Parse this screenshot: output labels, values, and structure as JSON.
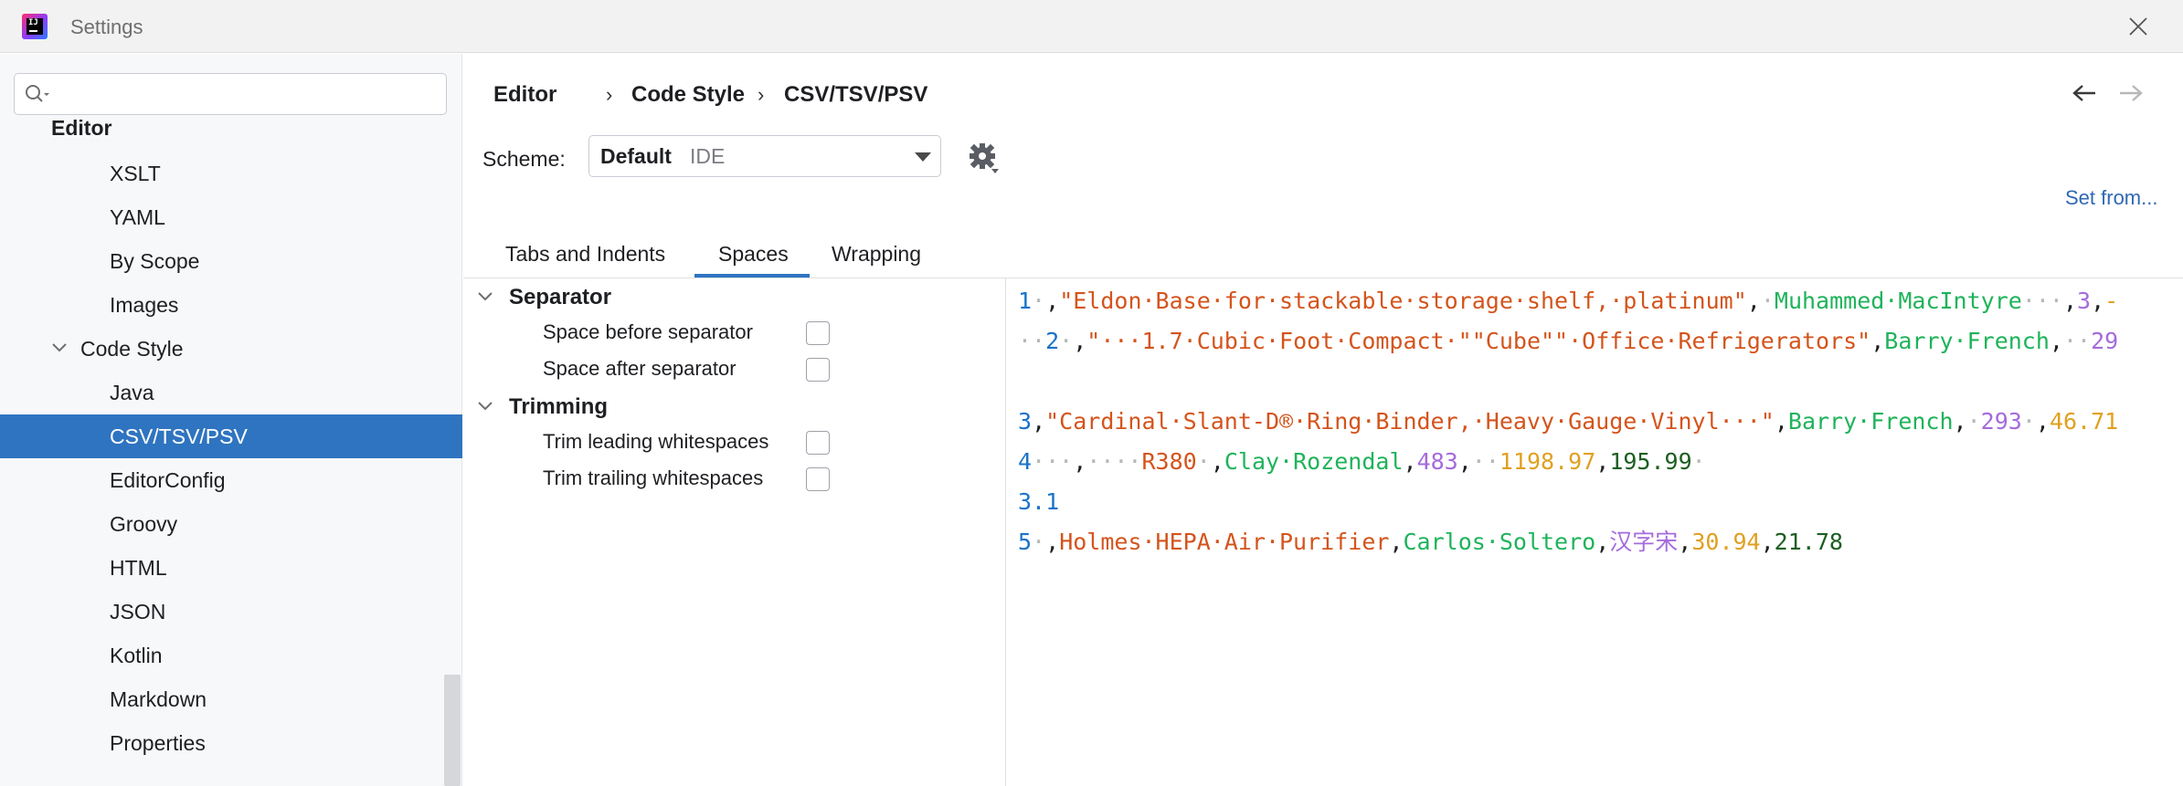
{
  "window": {
    "title": "Settings"
  },
  "sidebar": {
    "search_placeholder": "",
    "items": [
      {
        "label": "Editor",
        "level": 0,
        "bold": true
      },
      {
        "label": "XSLT",
        "level": 2
      },
      {
        "label": "YAML",
        "level": 2
      },
      {
        "label": "By Scope",
        "level": 2
      },
      {
        "label": "Images",
        "level": 2
      },
      {
        "label": "Code Style",
        "level": 1,
        "expanded": true
      },
      {
        "label": "Java",
        "level": 2
      },
      {
        "label": "CSV/TSV/PSV",
        "level": 2,
        "selected": true
      },
      {
        "label": "EditorConfig",
        "level": 2
      },
      {
        "label": "Groovy",
        "level": 2
      },
      {
        "label": "HTML",
        "level": 2
      },
      {
        "label": "JSON",
        "level": 2
      },
      {
        "label": "Kotlin",
        "level": 2
      },
      {
        "label": "Markdown",
        "level": 2
      },
      {
        "label": "Properties",
        "level": 2
      }
    ]
  },
  "breadcrumb": {
    "part1": "Editor",
    "part2": "Code Style",
    "part3": "CSV/TSV/PSV",
    "separator": "›"
  },
  "scheme": {
    "label": "Scheme:",
    "value": "Default",
    "sub": "IDE"
  },
  "set_from": "Set from...",
  "tabs": [
    {
      "label": "Tabs and Indents"
    },
    {
      "label": "Spaces",
      "active": true
    },
    {
      "label": "Wrapping"
    }
  ],
  "options": {
    "separator": {
      "title": "Separator",
      "space_before": {
        "label": "Space before separator",
        "checked": false
      },
      "space_after": {
        "label": "Space after separator",
        "checked": false
      }
    },
    "trimming": {
      "title": "Trimming",
      "trim_leading": {
        "label": "Trim leading whitespaces",
        "checked": false
      },
      "trim_trailing": {
        "label": "Trim trailing whitespaces",
        "checked": false
      }
    }
  },
  "preview": {
    "lines": [
      [
        {
          "t": "1",
          "c": "blue"
        },
        {
          "t": "·",
          "c": "ws"
        },
        {
          "t": ",",
          "c": "dark"
        },
        {
          "t": "\"Eldon·Base·for·stackable·storage·shelf,·platinum\"",
          "c": "orange"
        },
        {
          "t": ",",
          "c": "dark"
        },
        {
          "t": "·",
          "c": "ws"
        },
        {
          "t": "Muhammed·MacIntyre",
          "c": "green"
        },
        {
          "t": "···",
          "c": "ws"
        },
        {
          "t": ",",
          "c": "dark"
        },
        {
          "t": "3",
          "c": "purple"
        },
        {
          "t": ",",
          "c": "dark"
        },
        {
          "t": "-",
          "c": "gold"
        }
      ],
      [
        {
          "t": "··",
          "c": "ws"
        },
        {
          "t": "2",
          "c": "blue"
        },
        {
          "t": "·",
          "c": "ws"
        },
        {
          "t": ",",
          "c": "dark"
        },
        {
          "t": "\"···1.7·Cubic·Foot·Compact·\"\"Cube\"\"·Office·Refrigerators\"",
          "c": "orange"
        },
        {
          "t": ",",
          "c": "dark"
        },
        {
          "t": "Barry·French",
          "c": "green"
        },
        {
          "t": ",",
          "c": "dark"
        },
        {
          "t": "··",
          "c": "ws"
        },
        {
          "t": "29",
          "c": "purple"
        }
      ],
      [],
      [
        {
          "t": "3",
          "c": "blue"
        },
        {
          "t": ",",
          "c": "dark"
        },
        {
          "t": "\"Cardinal·Slant-D®·Ring·Binder,·Heavy·Gauge·Vinyl···\"",
          "c": "orange"
        },
        {
          "t": ",",
          "c": "dark"
        },
        {
          "t": "Barry·French",
          "c": "green"
        },
        {
          "t": ",",
          "c": "dark"
        },
        {
          "t": "·",
          "c": "ws"
        },
        {
          "t": "293",
          "c": "purple"
        },
        {
          "t": "·",
          "c": "ws"
        },
        {
          "t": ",",
          "c": "dark"
        },
        {
          "t": "46.71",
          "c": "gold"
        }
      ],
      [
        {
          "t": "4",
          "c": "blue"
        },
        {
          "t": "···",
          "c": "ws"
        },
        {
          "t": ",",
          "c": "dark"
        },
        {
          "t": "····",
          "c": "ws"
        },
        {
          "t": "R380",
          "c": "orange"
        },
        {
          "t": "·",
          "c": "ws"
        },
        {
          "t": ",",
          "c": "dark"
        },
        {
          "t": "Clay·Rozendal",
          "c": "green"
        },
        {
          "t": ",",
          "c": "dark"
        },
        {
          "t": "483",
          "c": "purple"
        },
        {
          "t": ",",
          "c": "dark"
        },
        {
          "t": "··",
          "c": "ws"
        },
        {
          "t": "1198.97",
          "c": "gold"
        },
        {
          "t": ",",
          "c": "dark"
        },
        {
          "t": "195.99",
          "c": "dgreen"
        },
        {
          "t": "·",
          "c": "ws"
        }
      ],
      [
        {
          "t": "3.1",
          "c": "blue"
        }
      ],
      [
        {
          "t": "5",
          "c": "blue"
        },
        {
          "t": "·",
          "c": "ws"
        },
        {
          "t": ",",
          "c": "dark"
        },
        {
          "t": "Holmes·HEPA·Air·Purifier",
          "c": "orange"
        },
        {
          "t": ",",
          "c": "dark"
        },
        {
          "t": "Carlos·Soltero",
          "c": "green"
        },
        {
          "t": ",",
          "c": "dark"
        },
        {
          "t": "汉字宋",
          "c": "purple"
        },
        {
          "t": ",",
          "c": "dark"
        },
        {
          "t": "30.94",
          "c": "gold"
        },
        {
          "t": ",",
          "c": "dark"
        },
        {
          "t": "21.78",
          "c": "dgreen"
        }
      ]
    ]
  },
  "colors": {
    "selection": "#2f74c0",
    "link": "#2f68b4",
    "sidebar_bg": "#f7f8fa"
  }
}
